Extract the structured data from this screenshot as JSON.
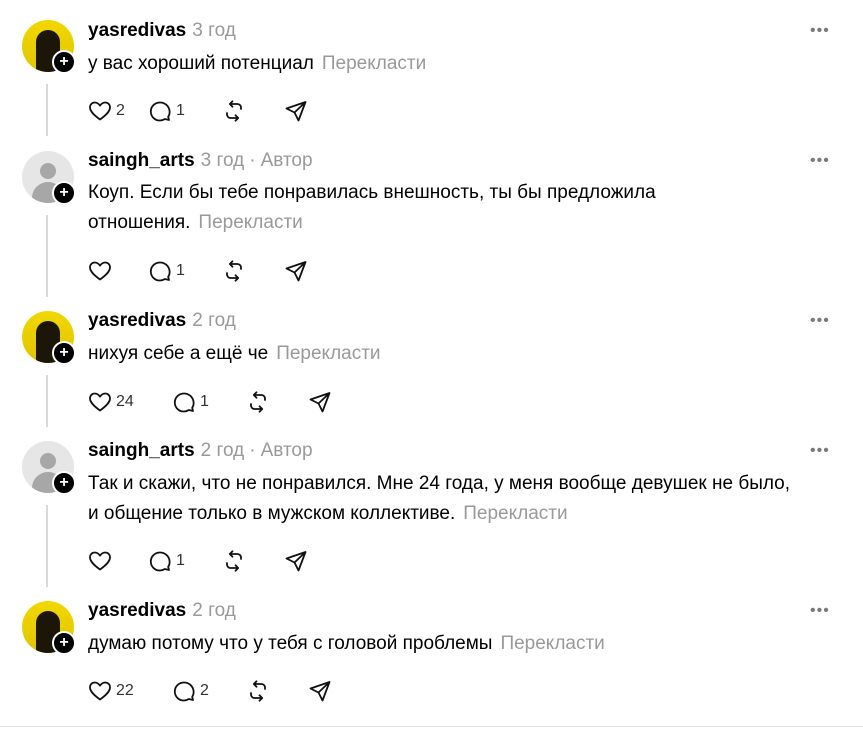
{
  "posts": [
    {
      "username": "yasredivas",
      "time": "3 год",
      "author_label": "",
      "text": "у вас хороший потенциал",
      "translate": "Перекласти",
      "likes": "2",
      "replies": "1",
      "avatar": "photo"
    },
    {
      "username": "saingh_arts",
      "time": "3 год",
      "author_label": "Автор",
      "text": "Коуп. Если бы тебе понравилась внешность, ты бы предложила отношения.",
      "translate": "Перекласти",
      "likes": "",
      "replies": "1",
      "avatar": "default"
    },
    {
      "username": "yasredivas",
      "time": "2 год",
      "author_label": "",
      "text": "нихуя себе а ещё че",
      "translate": "Перекласти",
      "likes": "24",
      "replies": "1",
      "avatar": "photo"
    },
    {
      "username": "saingh_arts",
      "time": "2 год",
      "author_label": "Автор",
      "text": "Так и скажи, что не понравился. Мне 24 года, у меня вообще девушек не было, и общение только в мужском коллективе.",
      "translate": "Перекласти",
      "likes": "",
      "replies": "1",
      "avatar": "default"
    },
    {
      "username": "yasredivas",
      "time": "2 год",
      "author_label": "",
      "text": "думаю потому что у тебя с головой проблемы",
      "translate": "Перекласти",
      "likes": "22",
      "replies": "2",
      "avatar": "photo"
    }
  ],
  "ui": {
    "separator": "·",
    "more_glyph": "•••",
    "follow_glyph": "+"
  },
  "icons": {
    "like": "heart-icon",
    "reply": "comment-icon",
    "repost": "repost-icon",
    "share": "send-icon",
    "more": "more-icon",
    "follow": "plus-icon"
  }
}
